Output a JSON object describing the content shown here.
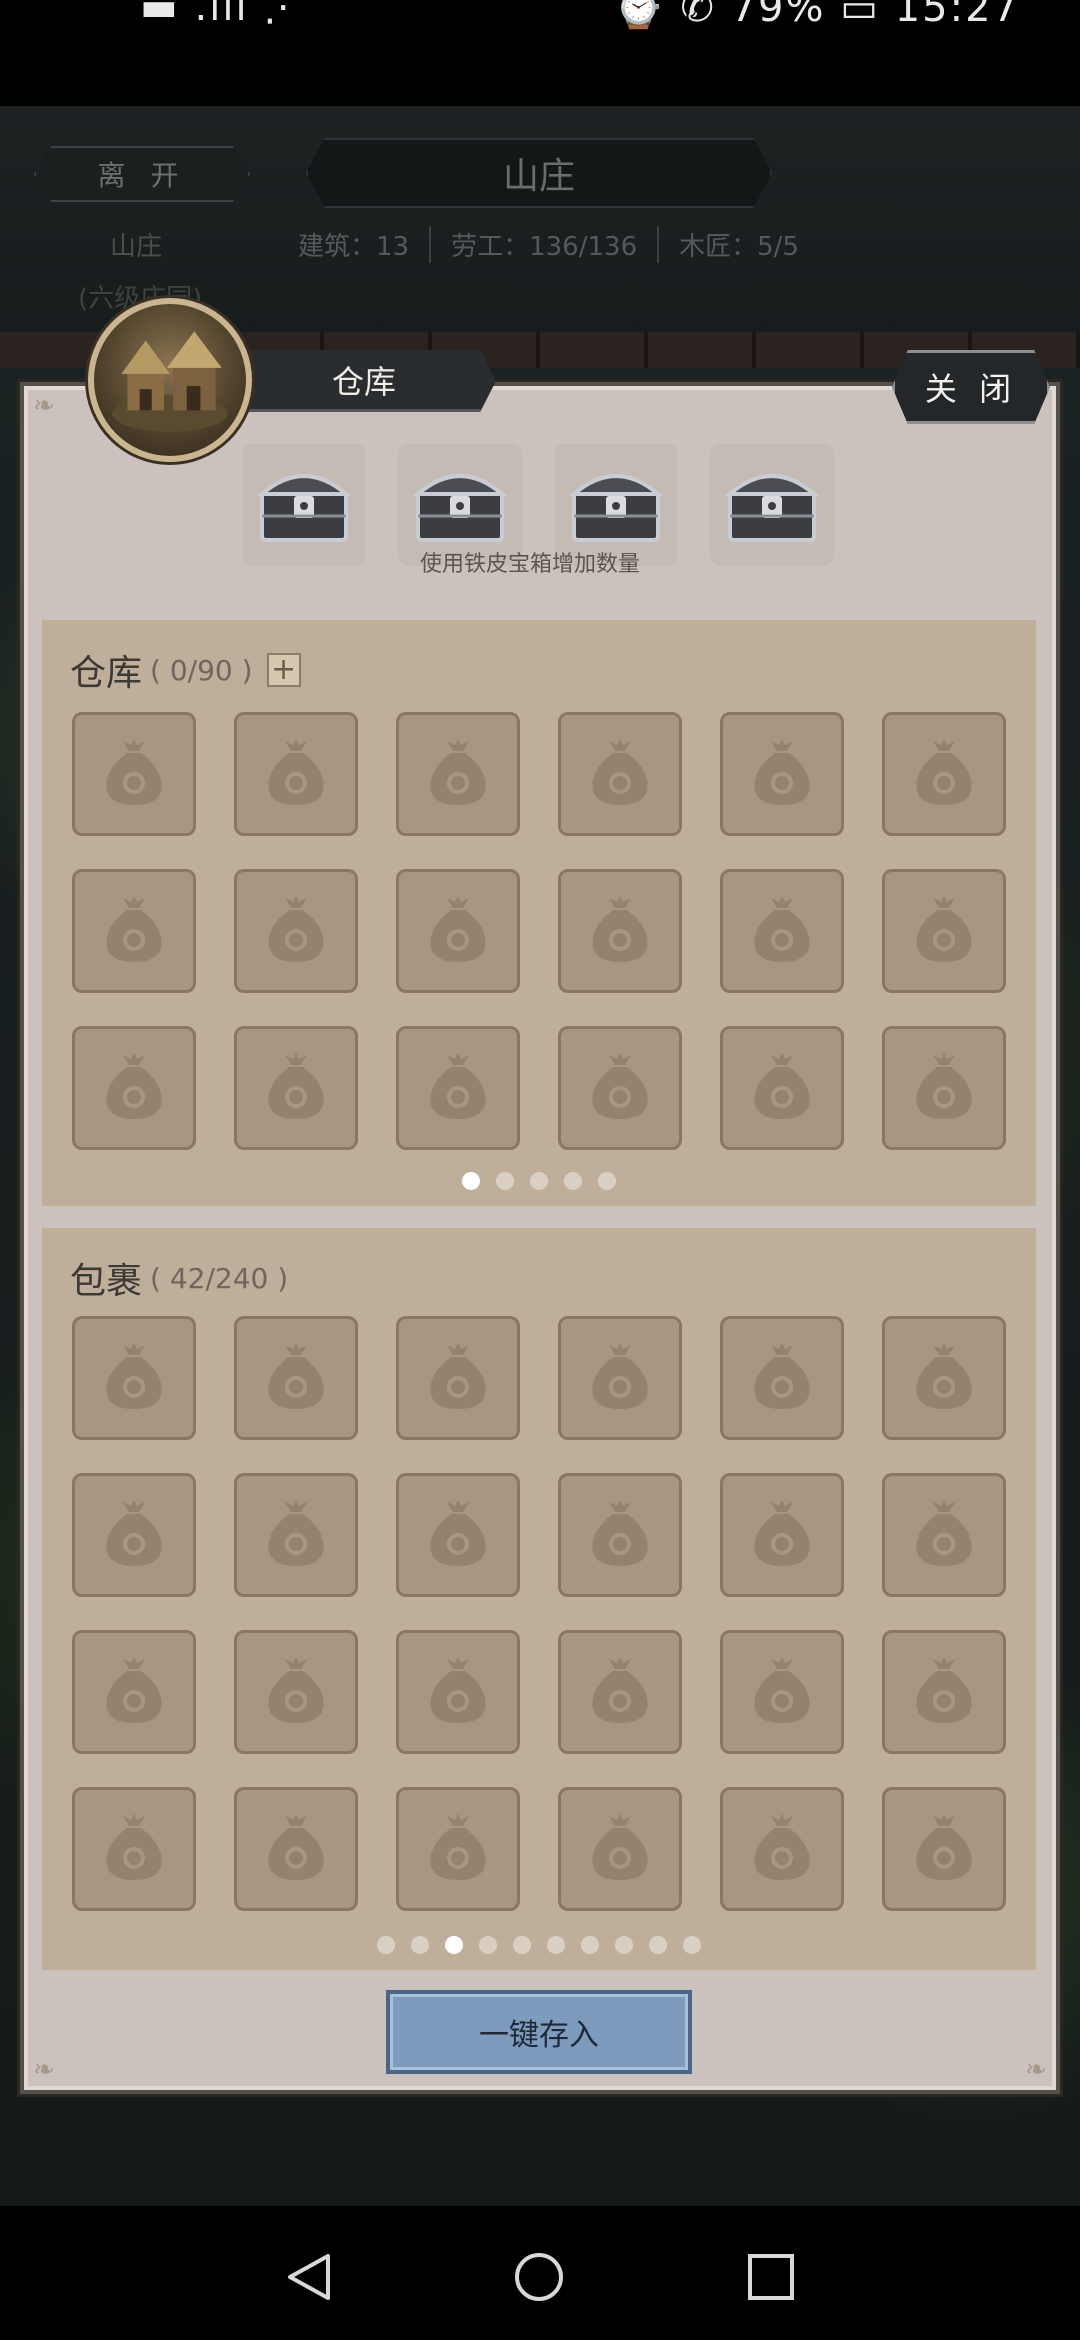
{
  "status_bar": {
    "left_text": "▬ .ıll ⋰",
    "right_text": "⌚ ✆ 79% ▭ 15:27"
  },
  "village": {
    "leave_label": "离 开",
    "title": "山庄",
    "name": "山庄",
    "level": "(六级庄园)",
    "stats": [
      "建筑：13",
      "劳工：136/136",
      "木匠：5/5"
    ]
  },
  "panel": {
    "title": "仓库",
    "close_label": "关 闭",
    "chest_hint": "使用铁皮宝箱增加数量",
    "chest_icon": "iron-chest-icon",
    "deposit_label": "一键存入"
  },
  "storage": {
    "title": "仓库",
    "count": "( 0/90 )",
    "plus_label": "+",
    "slot_icon": "money-bag-icon",
    "slot_count": 18,
    "pages": 5,
    "active_page": 1
  },
  "bag": {
    "title": "包裹",
    "count": "( 42/240 )",
    "slot_icon": "money-bag-icon",
    "slot_count": 24,
    "pages": 10,
    "active_page": 3
  },
  "colors": {
    "panel_bg": "#ccc2bd",
    "section_bg": "#bfae9a",
    "slot_bg": "#a99580",
    "button_blue": "#7e9bbd"
  },
  "navbar": {
    "icons": [
      "back-icon",
      "home-icon",
      "recent-apps-icon"
    ]
  }
}
